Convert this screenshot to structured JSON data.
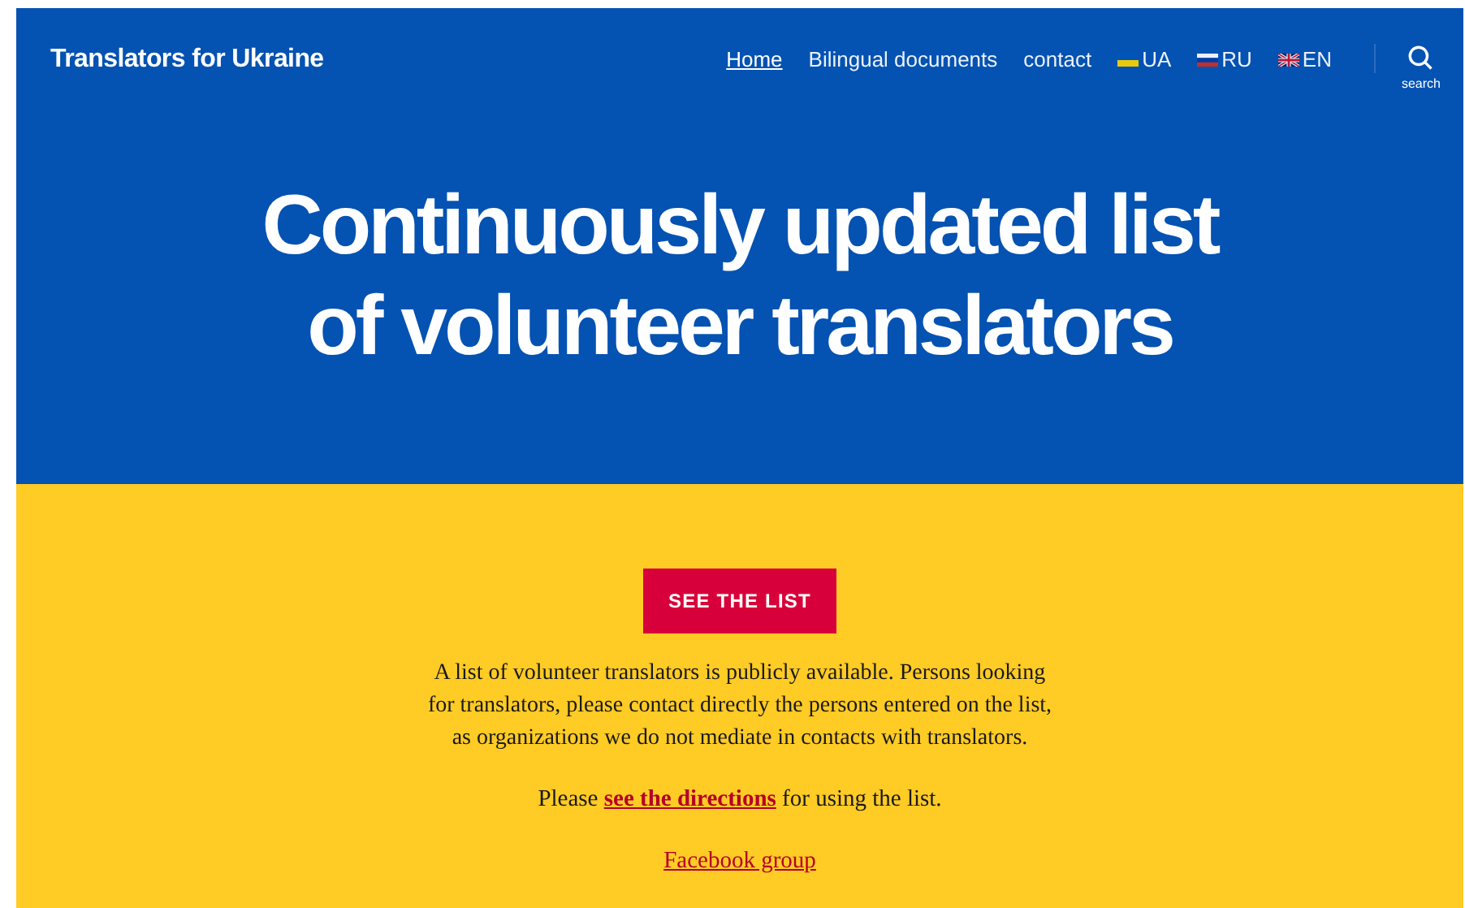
{
  "header": {
    "site_title": "Translators for Ukraine",
    "nav": [
      {
        "label": "Home",
        "kind": "link",
        "selected": true
      },
      {
        "label": "Bilingual documents",
        "kind": "link",
        "selected": false
      },
      {
        "label": "contact",
        "kind": "link",
        "selected": false
      },
      {
        "label": "UA",
        "kind": "ua",
        "selected": false
      },
      {
        "label": "RU",
        "kind": "ru",
        "selected": false
      },
      {
        "label": "EN",
        "kind": "gb",
        "selected": false
      }
    ],
    "search_label": "search"
  },
  "hero": {
    "title_lines": [
      "Continuously updated list",
      "of volunteer translators"
    ]
  },
  "content": {
    "button": "SEE THE LIST",
    "paragraph": "A list of volunteer translators is publicly available. Persons looking for translators, please contact directly the persons entered on the list, as organizations we do not mediate in contacts with translators.",
    "directions": {
      "before": "Please ",
      "link": "see the directions",
      "after": " for using the list."
    },
    "facebook_link": "Facebook group"
  }
}
